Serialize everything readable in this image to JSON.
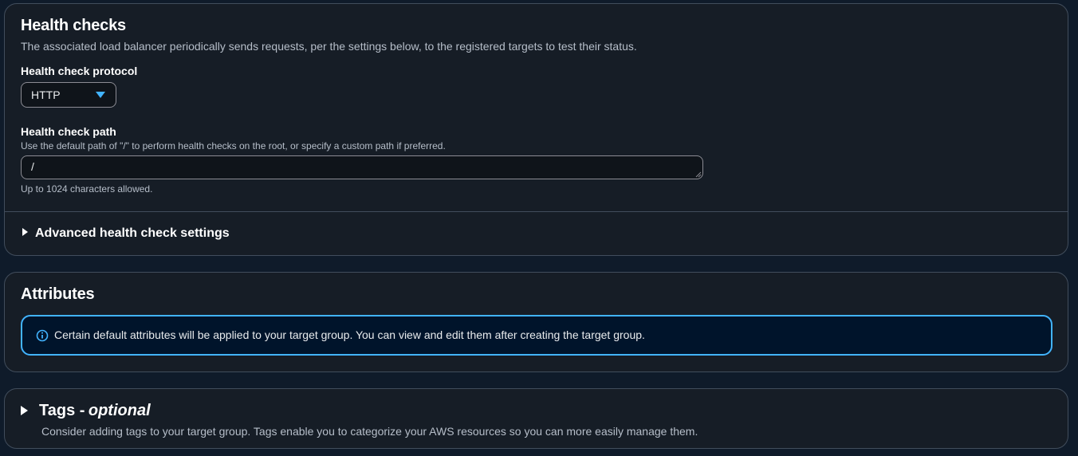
{
  "health_checks": {
    "title": "Health checks",
    "description": "The associated load balancer periodically sends requests, per the settings below, to the registered targets to test their status.",
    "protocol_label": "Health check protocol",
    "protocol_value": "HTTP",
    "path_label": "Health check path",
    "path_description": "Use the default path of \"/\" to perform health checks on the root, or specify a custom path if preferred.",
    "path_value": "/",
    "path_constraint": "Up to 1024 characters allowed.",
    "advanced_label": "Advanced health check settings"
  },
  "attributes": {
    "title": "Attributes",
    "info_text": "Certain default attributes will be applied to your target group. You can view and edit them after creating the target group.",
    "info_icon": "info-icon"
  },
  "tags": {
    "title": "Tags -",
    "optional": "optional",
    "description": "Consider adding tags to your target group. Tags enable you to categorize your AWS resources so you can more easily manage them."
  },
  "colors": {
    "background": "#0f1b2a",
    "panel": "#161d26",
    "border": "#414d5c",
    "accent": "#42b4ff",
    "info_background": "#00142b"
  }
}
